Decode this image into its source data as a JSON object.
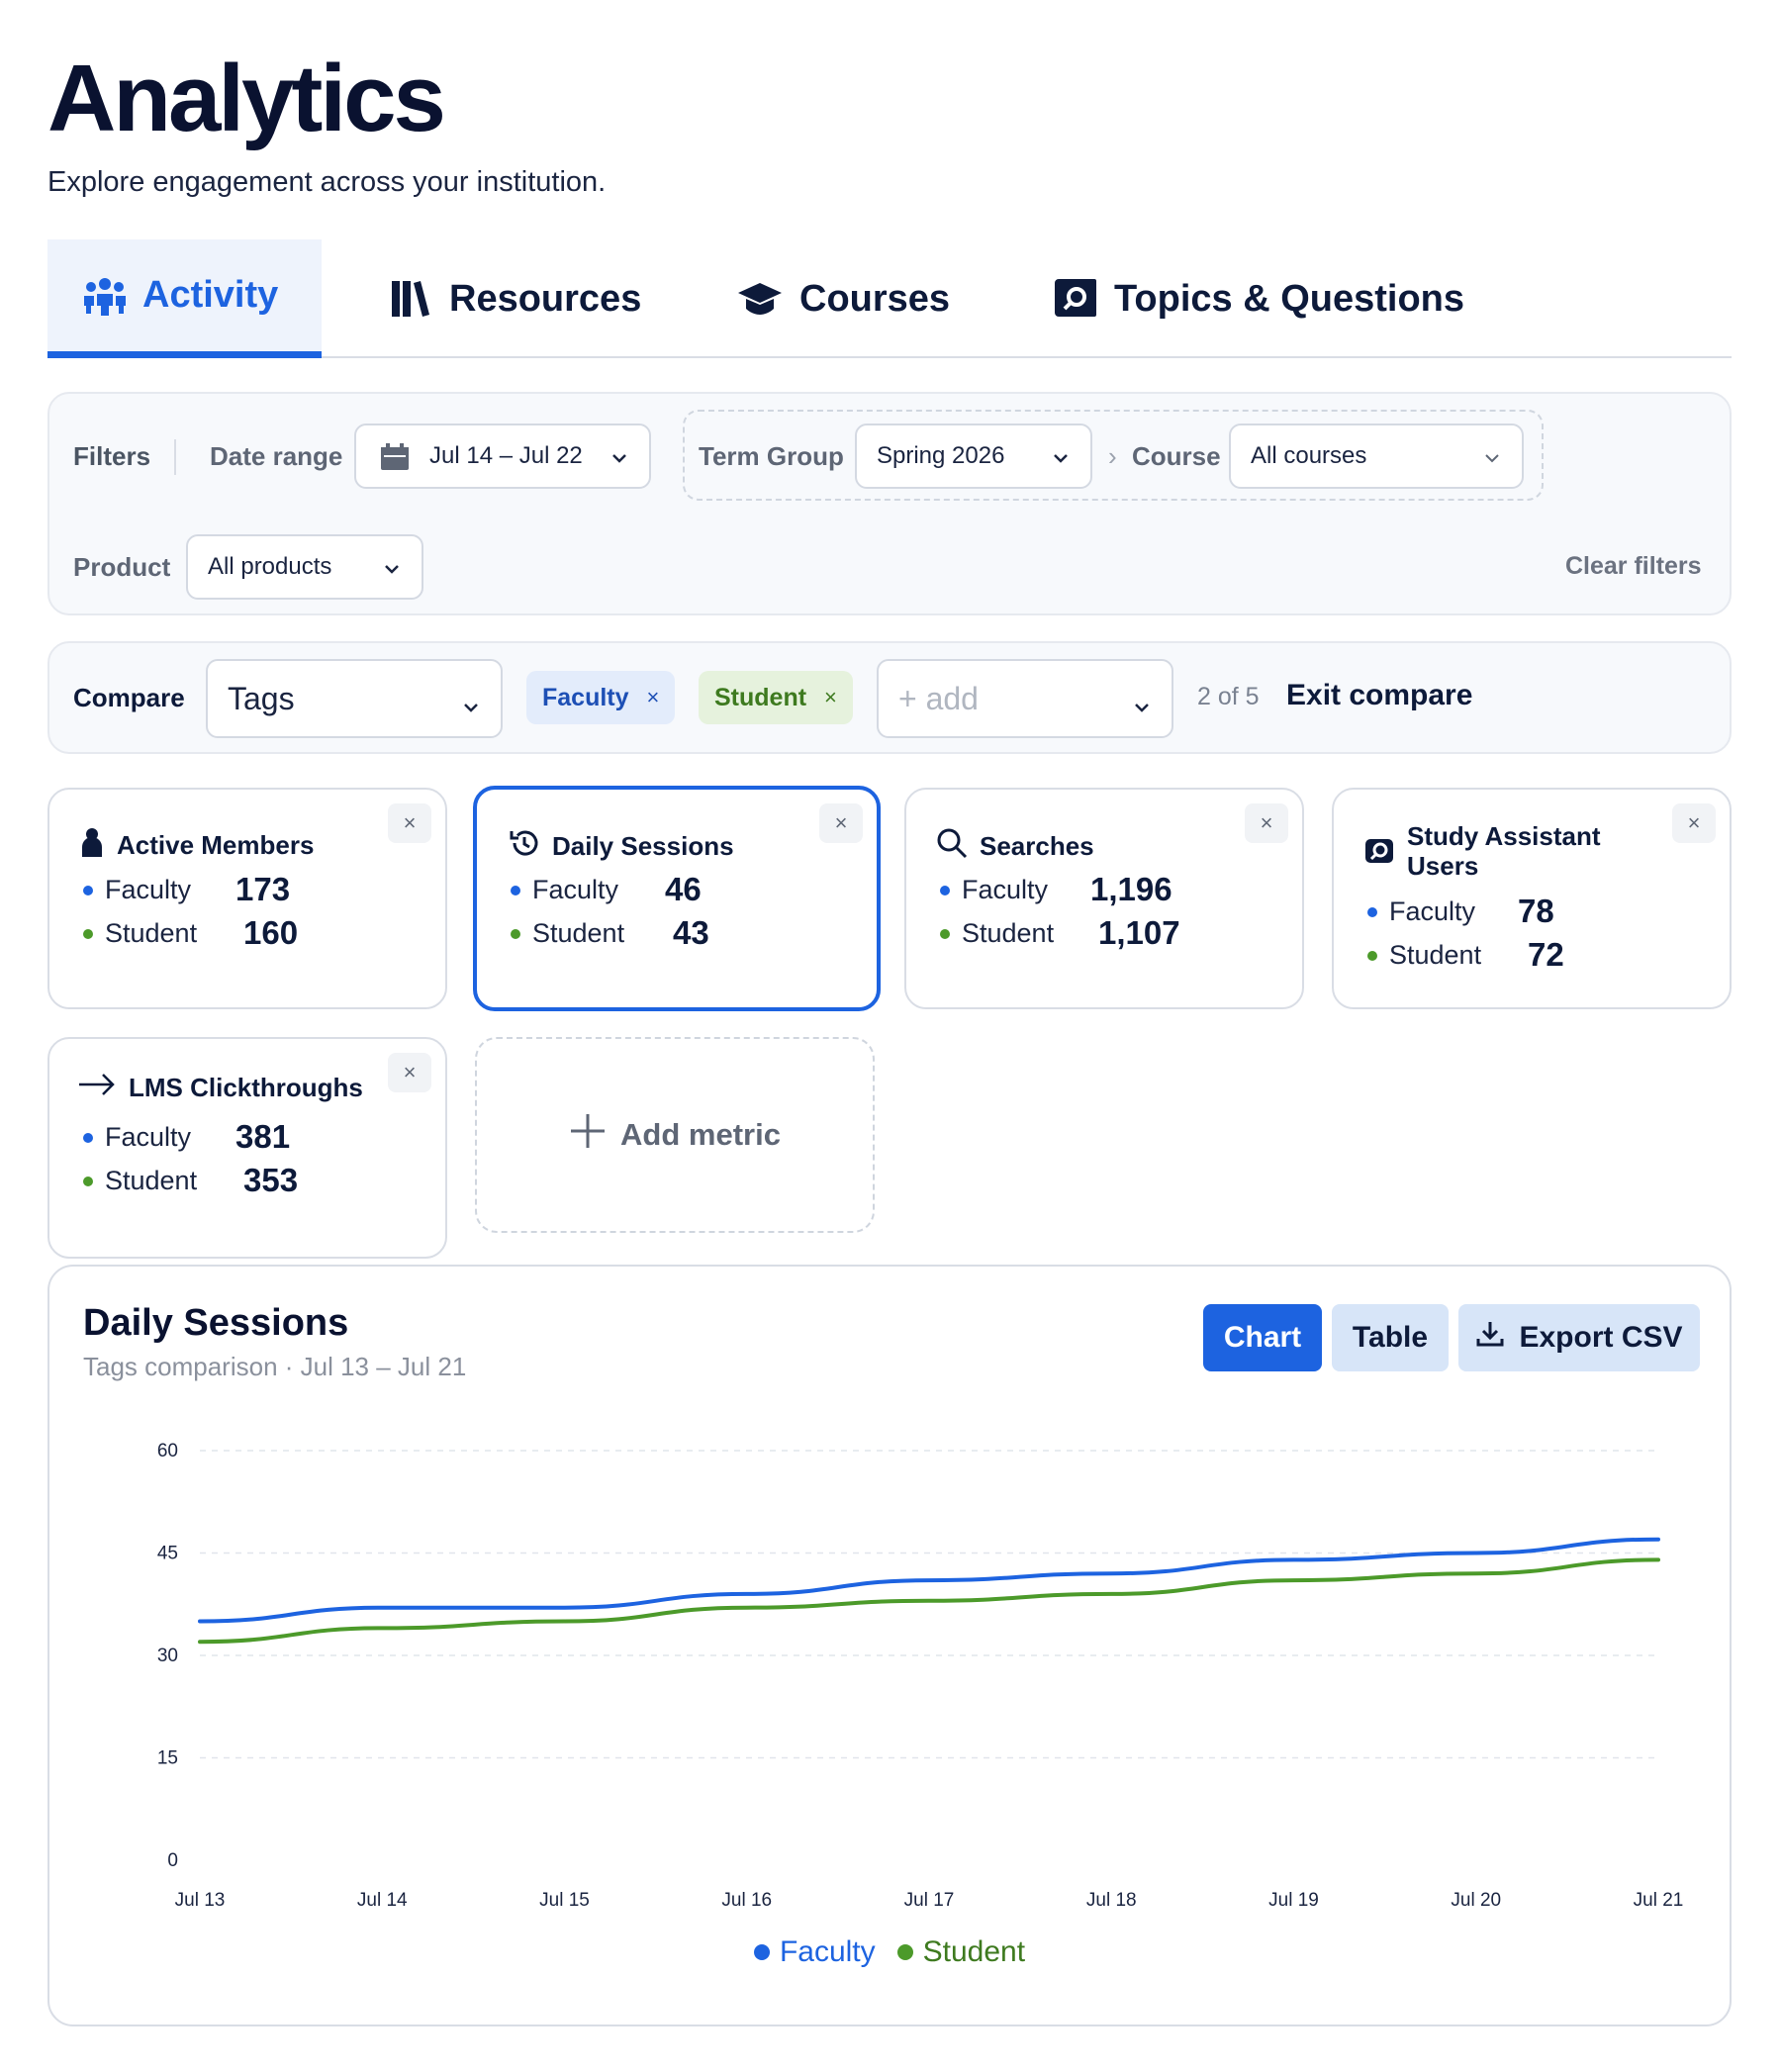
{
  "header": {
    "title": "Analytics",
    "subtitle": "Explore engagement across your institution."
  },
  "tabs": [
    {
      "label": "Activity",
      "icon": "people-icon",
      "active": true
    },
    {
      "label": "Resources",
      "icon": "library-icon"
    },
    {
      "label": "Courses",
      "icon": "graduation-cap-icon"
    },
    {
      "label": "Topics & Questions",
      "icon": "topic-search-icon"
    }
  ],
  "filters": {
    "label": "Filters",
    "date_range_label": "Date range",
    "date_range_value": "Jul 14 – Jul 22",
    "term_group_label": "Term Group",
    "term_group_value": "Spring 2026",
    "breadcrumb_sep": "›",
    "course_label": "Course",
    "course_value": "All courses",
    "product_label": "Product",
    "product_value": "All products",
    "clear_label": "Clear filters"
  },
  "compare": {
    "label": "Compare",
    "by_value": "Tags",
    "chips": [
      {
        "label": "Faculty",
        "remove": "×"
      },
      {
        "label": "Student",
        "remove": "×"
      }
    ],
    "add_placeholder": "+ add",
    "counter": "2 of 5",
    "exit_label": "Exit compare"
  },
  "metrics": [
    {
      "title": "Active Members",
      "icon": "person-icon",
      "faculty_label": "Faculty",
      "faculty": "173",
      "student_label": "Student",
      "student": "160",
      "close": "×"
    },
    {
      "title": "Daily Sessions",
      "icon": "history-icon",
      "faculty_label": "Faculty",
      "faculty": "46",
      "student_label": "Student",
      "student": "43",
      "close": "×",
      "selected": true
    },
    {
      "title": "Searches",
      "icon": "search-icon",
      "faculty_label": "Faculty",
      "faculty": "1,196",
      "student_label": "Student",
      "student": "1,107",
      "close": "×"
    },
    {
      "title_line1": "Study Assistant",
      "title_line2": "Users",
      "icon": "assistant-icon",
      "faculty_label": "Faculty",
      "faculty": "78",
      "student_label": "Student",
      "student": "72",
      "close": "×"
    },
    {
      "title": "LMS Clickthroughs",
      "icon": "arrow-right-icon",
      "faculty_label": "Faculty",
      "faculty": "381",
      "student_label": "Student",
      "student": "353",
      "close": "×"
    }
  ],
  "add_metric_label": "Add metric",
  "chart_section": {
    "title": "Daily Sessions",
    "subtitle": "Tags comparison · Jul 13 – Jul 21",
    "chart_button": "Chart",
    "table_button": "Table",
    "export_button": "Export CSV"
  },
  "colors": {
    "faculty": "#1d63e0",
    "student": "#4c9a2a",
    "accent": "#1d63e0"
  },
  "chart_data": {
    "type": "line",
    "categories": [
      "Jul 13",
      "Jul 14",
      "Jul 15",
      "Jul 16",
      "Jul 17",
      "Jul 18",
      "Jul 19",
      "Jul 20",
      "Jul 21"
    ],
    "series": [
      {
        "name": "Faculty",
        "values": [
          35,
          37,
          37,
          39,
          41,
          42,
          44,
          45,
          47
        ]
      },
      {
        "name": "Student",
        "values": [
          32,
          34,
          35,
          37,
          38,
          39,
          41,
          42,
          44
        ]
      }
    ],
    "yticks": [
      "60",
      "45",
      "30",
      "15",
      "0"
    ],
    "ylim": [
      0,
      60
    ],
    "grid": true,
    "legend_position": "bottom-center"
  }
}
